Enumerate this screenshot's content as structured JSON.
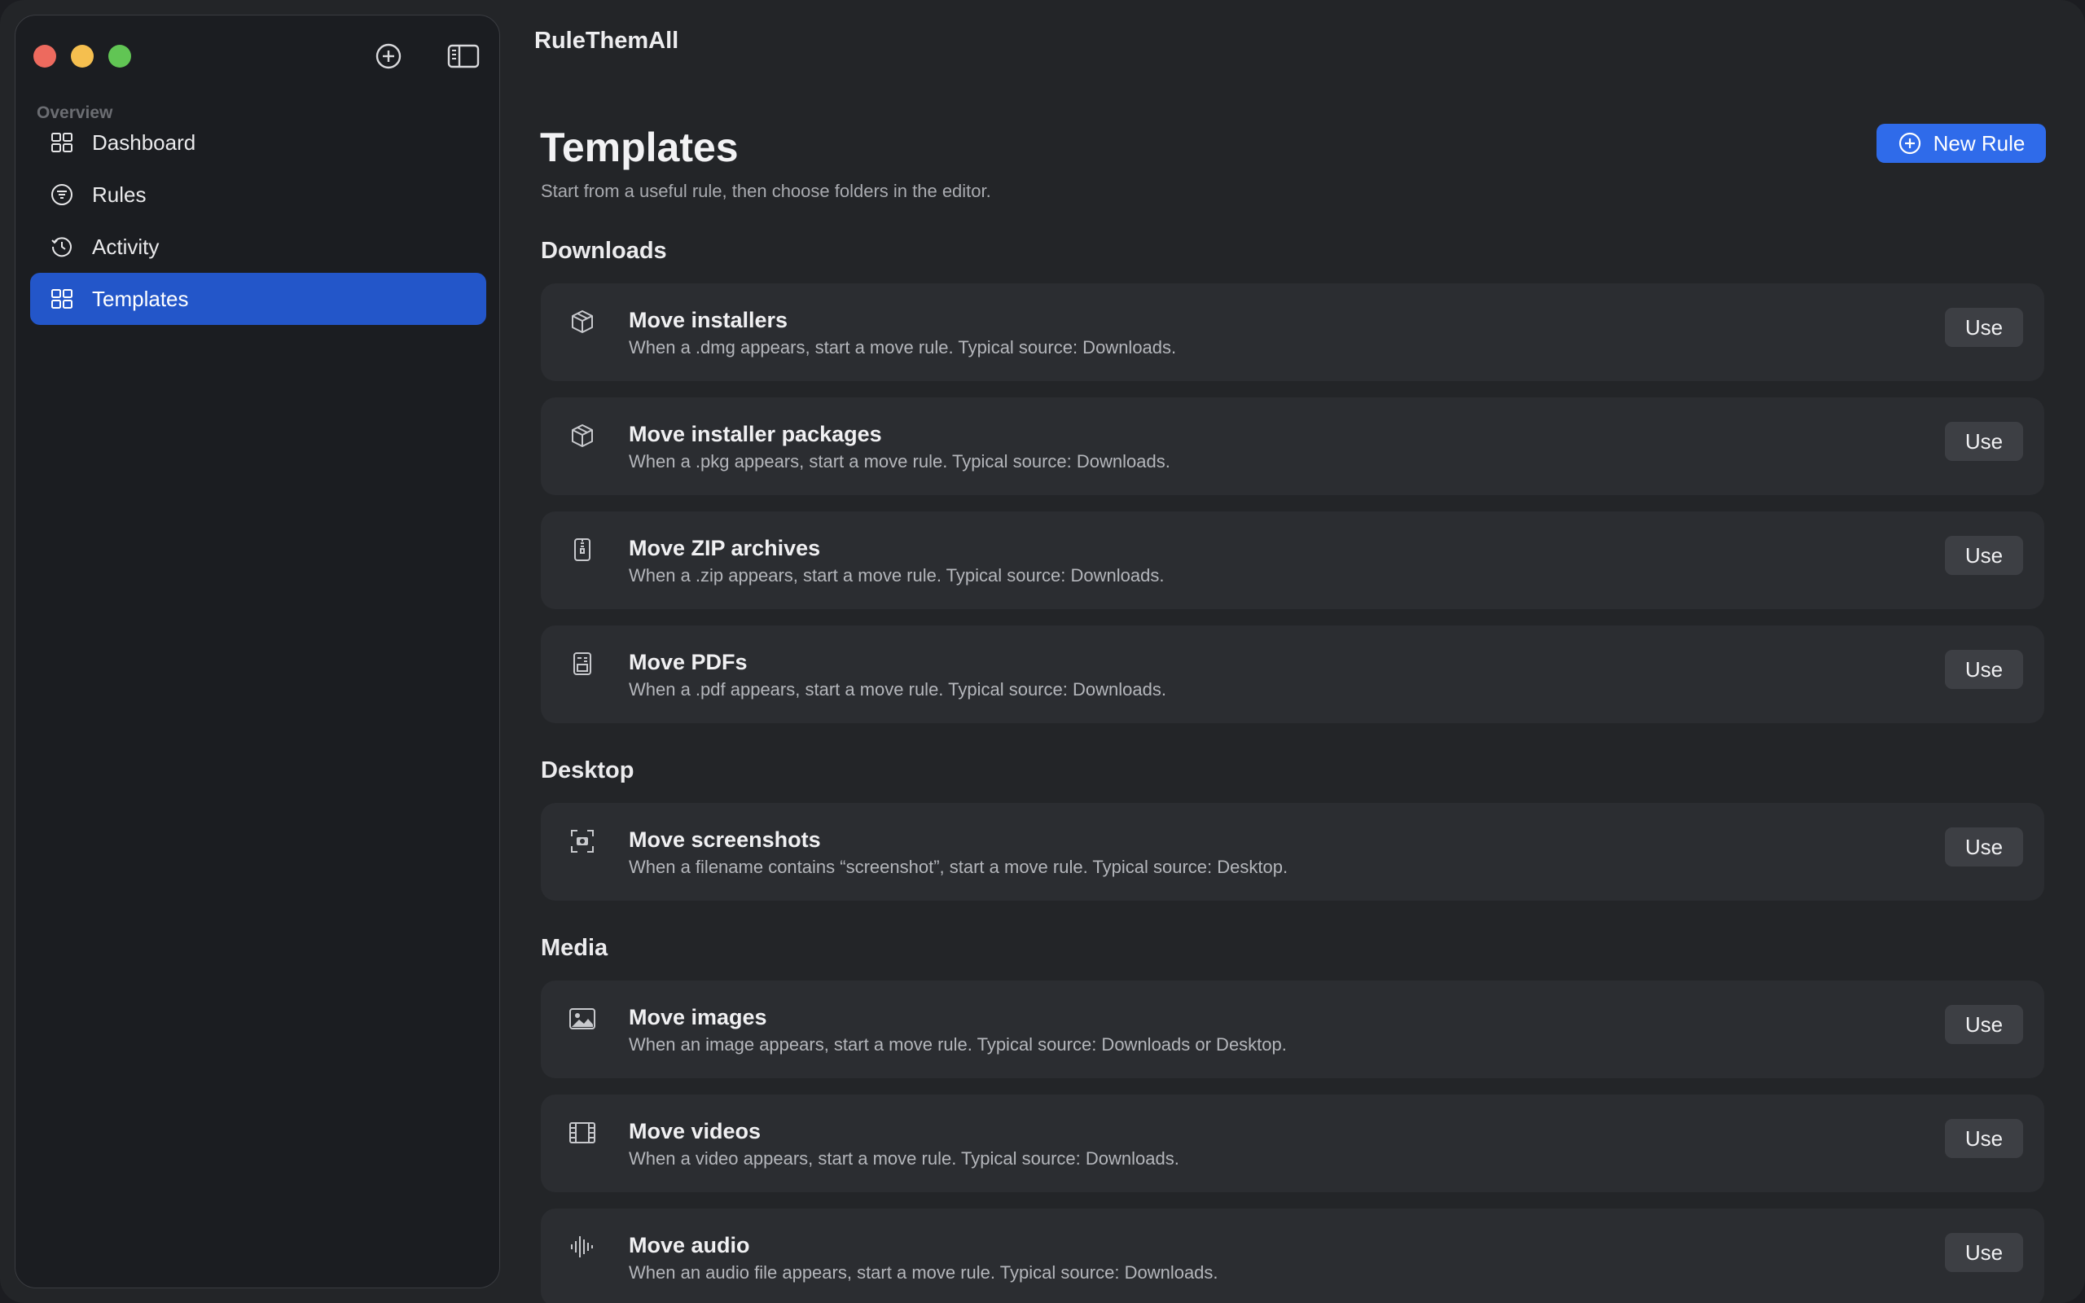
{
  "app": {
    "title": "RuleThemAll"
  },
  "sidebar": {
    "section": "Overview",
    "items": [
      {
        "label": "Dashboard",
        "icon": "grid-icon"
      },
      {
        "label": "Rules",
        "icon": "filter-icon"
      },
      {
        "label": "Activity",
        "icon": "history-icon"
      },
      {
        "label": "Templates",
        "icon": "grid-icon",
        "active": true
      }
    ]
  },
  "page": {
    "title": "Templates",
    "subtitle": "Start from a useful rule, then choose folders in the editor.",
    "new_rule_label": "New Rule"
  },
  "groups": [
    {
      "title": "Downloads",
      "cards": [
        {
          "title": "Move installers",
          "desc": "When a .dmg appears, start a move rule. Typical source: Downloads.",
          "icon": "box-icon",
          "button": "Use"
        },
        {
          "title": "Move installer packages",
          "desc": "When a .pkg appears, start a move rule. Typical source: Downloads.",
          "icon": "box-icon",
          "button": "Use"
        },
        {
          "title": "Move ZIP archives",
          "desc": "When a .zip appears, start a move rule. Typical source: Downloads.",
          "icon": "zipper-icon",
          "button": "Use"
        },
        {
          "title": "Move PDFs",
          "desc": "When a .pdf appears, start a move rule. Typical source: Downloads.",
          "icon": "document-icon",
          "button": "Use"
        }
      ]
    },
    {
      "title": "Desktop",
      "cards": [
        {
          "title": "Move screenshots",
          "desc": "When a filename contains “screenshot”, start a move rule. Typical source: Desktop.",
          "icon": "camera-viewfinder-icon",
          "button": "Use"
        }
      ]
    },
    {
      "title": "Media",
      "cards": [
        {
          "title": "Move images",
          "desc": "When an image appears, start a move rule. Typical source: Downloads or Desktop.",
          "icon": "photo-icon",
          "button": "Use"
        },
        {
          "title": "Move videos",
          "desc": "When a video appears, start a move rule. Typical source: Downloads.",
          "icon": "film-icon",
          "button": "Use"
        },
        {
          "title": "Move audio",
          "desc": "When an audio file appears, start a move rule. Typical source: Downloads.",
          "icon": "waveform-icon",
          "button": "Use"
        }
      ]
    }
  ],
  "colors": {
    "accent": "#2f6bea",
    "sidebar_active": "#2356c9",
    "card_bg": "#2b2d31"
  }
}
